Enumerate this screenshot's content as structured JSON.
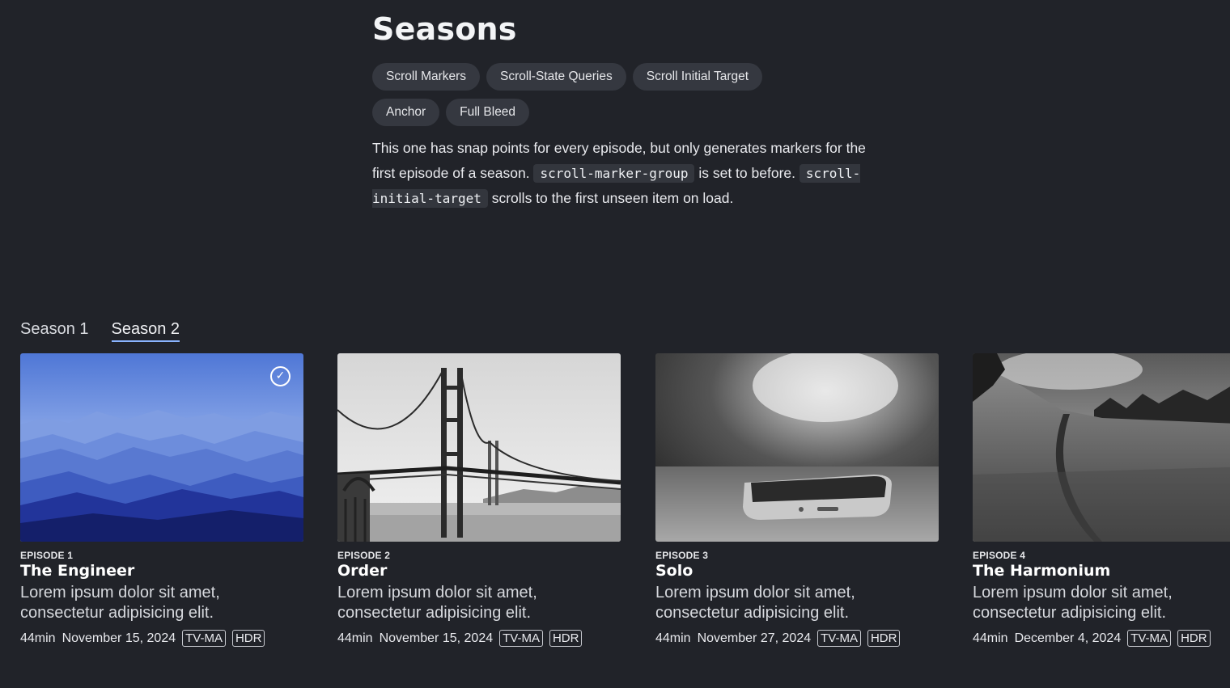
{
  "header": {
    "title": "Seasons",
    "chips": [
      "Scroll Markers",
      "Scroll-State Queries",
      "Scroll Initial Target",
      "Anchor",
      "Full Bleed"
    ],
    "desc": {
      "t1": "This one has snap points for every episode, but only generates markers for the first episode of a season.",
      "c1": "scroll-marker-group",
      "t2": "is set to before.",
      "c2": "scroll-initial-target",
      "t3": "scrolls to the first unseen item on load."
    }
  },
  "seasons": {
    "tab1": "Season 1",
    "tab2": "Season 2",
    "active": "Season 2"
  },
  "episodes": [
    {
      "number": "EPISODE 1",
      "title": "The Engineer",
      "desc": "Lorem ipsum dolor sit amet, consectetur adipisicing elit.",
      "duration": "44min",
      "date": "November 15, 2024",
      "rating": "TV-MA",
      "format": "HDR",
      "watched": true,
      "image": "blue-mountains"
    },
    {
      "number": "EPISODE 2",
      "title": "Order",
      "desc": "Lorem ipsum dolor sit amet, consectetur adipisicing elit.",
      "duration": "44min",
      "date": "November 15, 2024",
      "rating": "TV-MA",
      "format": "HDR",
      "watched": false,
      "image": "golden-gate-bridge"
    },
    {
      "number": "EPISODE 3",
      "title": "Solo",
      "desc": "Lorem ipsum dolor sit amet, consectetur adipisicing elit.",
      "duration": "44min",
      "date": "November 27, 2024",
      "rating": "TV-MA",
      "format": "HDR",
      "watched": false,
      "image": "phone-on-table"
    },
    {
      "number": "EPISODE 4",
      "title": "The Harmonium",
      "desc": "Lorem ipsum dolor sit amet, consectetur adipisicing elit.",
      "duration": "44min",
      "date": "December 4, 2024",
      "rating": "TV-MA",
      "format": "HDR",
      "watched": false,
      "image": "meadow-path"
    }
  ],
  "colors": {
    "background": "#212329",
    "chip": "#353840",
    "active_tab_underline": "#8ab4ff"
  }
}
